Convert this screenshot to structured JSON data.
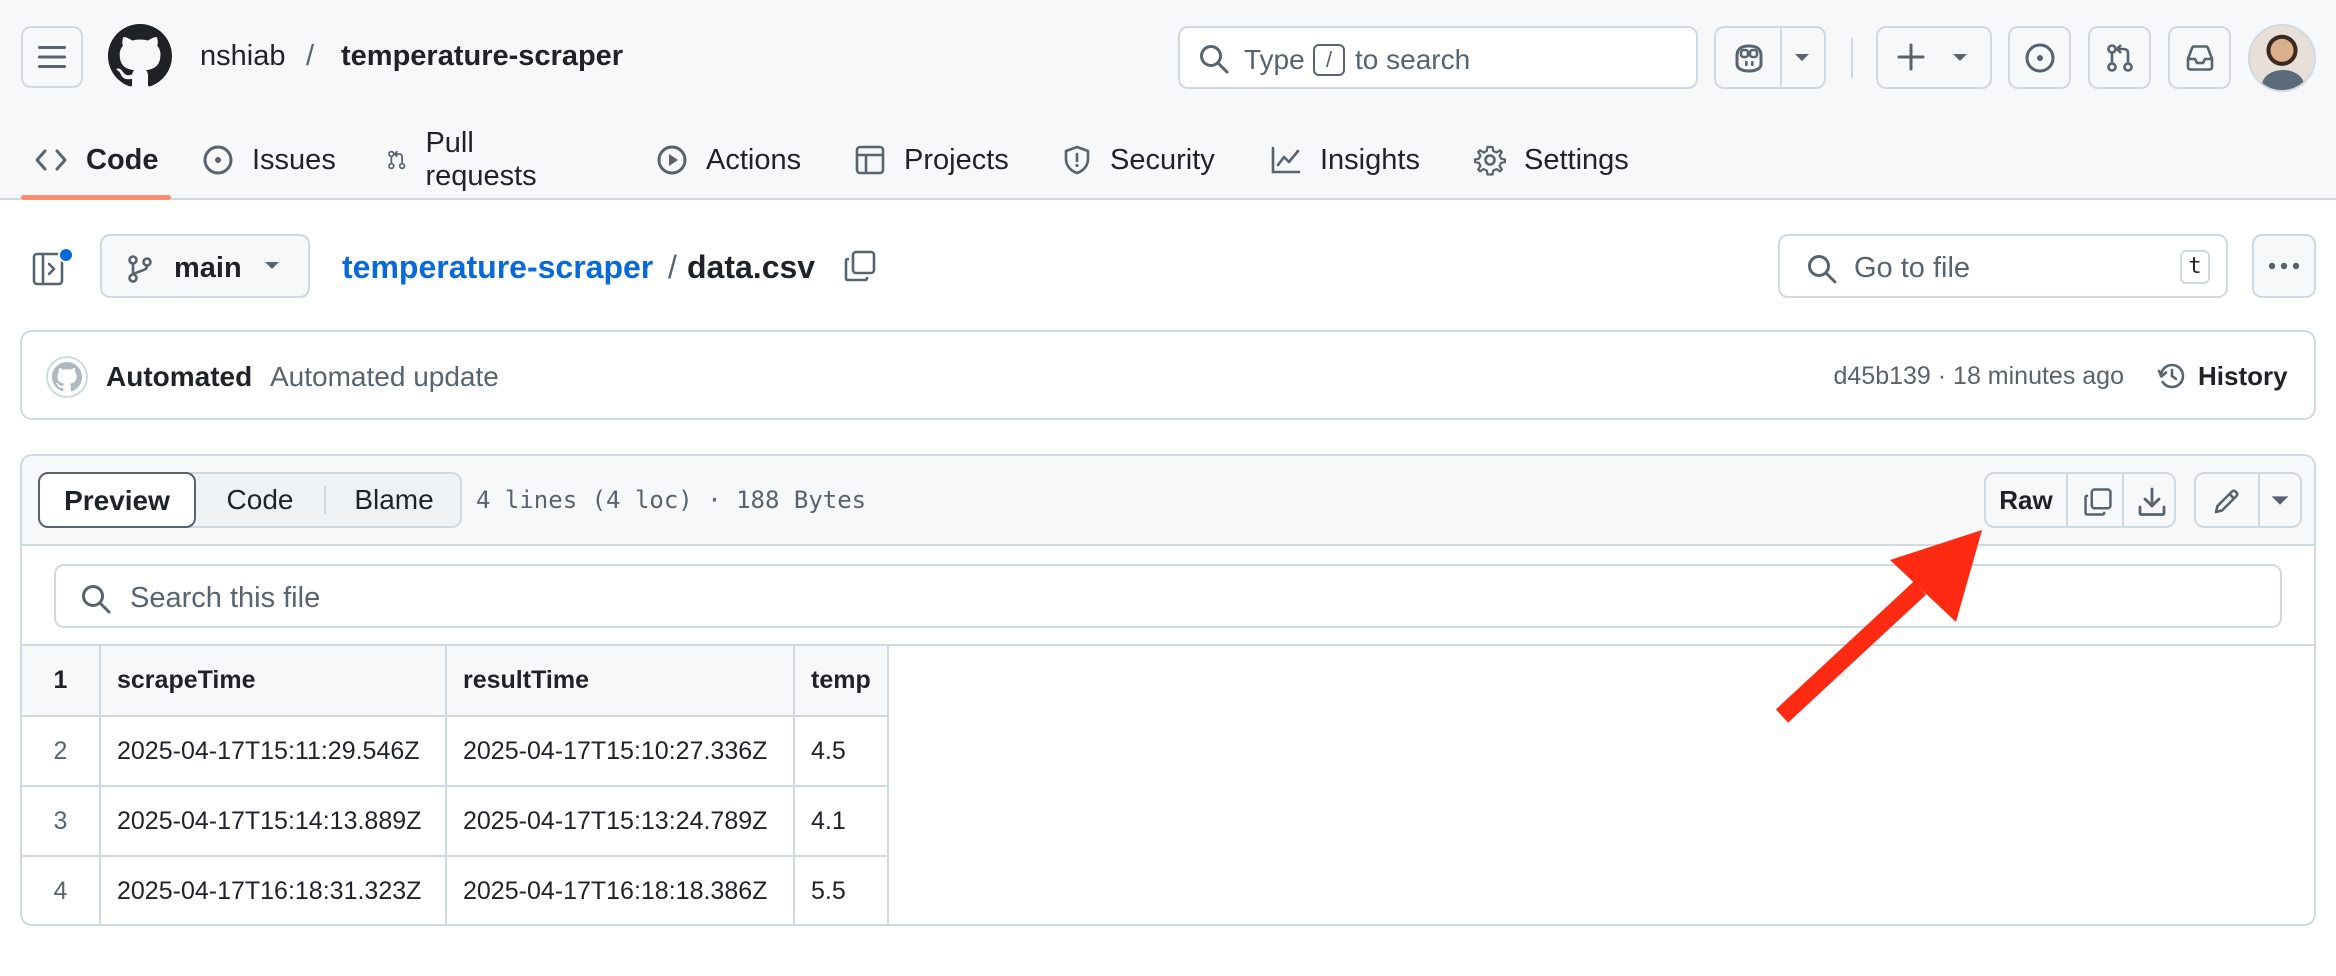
{
  "header": {
    "owner": "nshiab",
    "separator": "/",
    "repo": "temperature-scraper",
    "search": {
      "prefix": "Type",
      "key": "/",
      "suffix": "to search"
    }
  },
  "nav": {
    "tabs": [
      {
        "id": "code",
        "label": "Code",
        "icon": "code-icon"
      },
      {
        "id": "issues",
        "label": "Issues",
        "icon": "issue-icon"
      },
      {
        "id": "pull-requests",
        "label": "Pull requests",
        "icon": "pull-request-icon"
      },
      {
        "id": "actions",
        "label": "Actions",
        "icon": "play-icon"
      },
      {
        "id": "projects",
        "label": "Projects",
        "icon": "table-icon"
      },
      {
        "id": "security",
        "label": "Security",
        "icon": "shield-icon"
      },
      {
        "id": "insights",
        "label": "Insights",
        "icon": "graph-icon"
      },
      {
        "id": "settings",
        "label": "Settings",
        "icon": "gear-icon"
      }
    ],
    "active": "code"
  },
  "file_header": {
    "branch": "main",
    "crumb_repo": "temperature-scraper",
    "crumb_sep": "/",
    "file_name": "data.csv",
    "goto_placeholder": "Go to file",
    "goto_key": "t"
  },
  "commit": {
    "author": "Automated",
    "message": "Automated update",
    "meta": "d45b139 · 18 minutes ago",
    "history_label": "History"
  },
  "viewer": {
    "tabs": [
      "Preview",
      "Code",
      "Blame"
    ],
    "active_tab": "Preview",
    "file_info": "4 lines (4 loc) · 188 Bytes",
    "raw_label": "Raw",
    "search_placeholder": "Search this file"
  },
  "csv": {
    "header_line": "1",
    "columns": [
      "scrapeTime",
      "resultTime",
      "temp"
    ],
    "rows": [
      {
        "line": "2",
        "cells": [
          "2025-04-17T15:11:29.546Z",
          "2025-04-17T15:10:27.336Z",
          "4.5"
        ]
      },
      {
        "line": "3",
        "cells": [
          "2025-04-17T15:14:13.889Z",
          "2025-04-17T15:13:24.789Z",
          "4.1"
        ]
      },
      {
        "line": "4",
        "cells": [
          "2025-04-17T16:18:31.323Z",
          "2025-04-17T16:18:18.386Z",
          "5.5"
        ]
      }
    ]
  },
  "colors": {
    "accent_link": "#0969da",
    "tab_underline": "#fd8c73",
    "annotation_arrow": "#ff2a12",
    "notification_dot": "#0969da"
  }
}
